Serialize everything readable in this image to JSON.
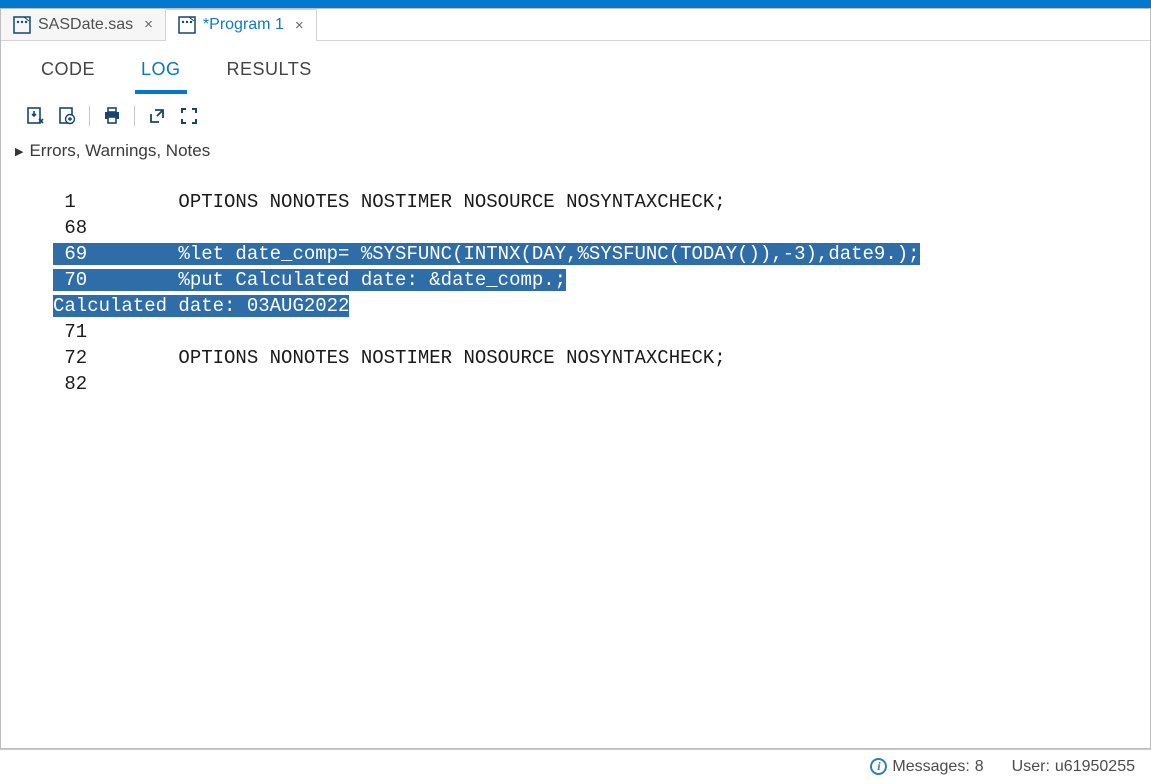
{
  "file_tabs": [
    {
      "label": "SASDate.sas",
      "active": false
    },
    {
      "label": "*Program 1",
      "active": true
    }
  ],
  "view_tabs": [
    {
      "label": "CODE",
      "active": false
    },
    {
      "label": "LOG",
      "active": true
    },
    {
      "label": "RESULTS",
      "active": false
    }
  ],
  "collapse_label": "Errors, Warnings, Notes",
  "log_lines": [
    {
      "num": "1",
      "pad": "         ",
      "text": "OPTIONS NONOTES NOSTIMER NOSOURCE NOSYNTAXCHECK;",
      "hl": false
    },
    {
      "num": "68",
      "pad": "        ",
      "text": "",
      "hl": false
    },
    {
      "num": "69",
      "pad": "        ",
      "text": "%let date_comp= %SYSFUNC(INTNX(DAY,%SYSFUNC(TODAY()),-3),date9.);",
      "hl": true
    },
    {
      "num": "70",
      "pad": "        ",
      "text": "%put Calculated date: &date_comp.;",
      "hl": true
    },
    {
      "num": "",
      "pad": "",
      "text": "Calculated date: 03AUG2022",
      "hl": true
    },
    {
      "num": "71",
      "pad": "        ",
      "text": "",
      "hl": false
    },
    {
      "num": "72",
      "pad": "        ",
      "text": "OPTIONS NONOTES NOSTIMER NOSOURCE NOSYNTAXCHECK;",
      "hl": false
    },
    {
      "num": "82",
      "pad": "        ",
      "text": "",
      "hl": false
    }
  ],
  "status": {
    "messages_label": "Messages:",
    "messages_count": "8",
    "user_label": "User:",
    "user_value": "u61950255"
  }
}
